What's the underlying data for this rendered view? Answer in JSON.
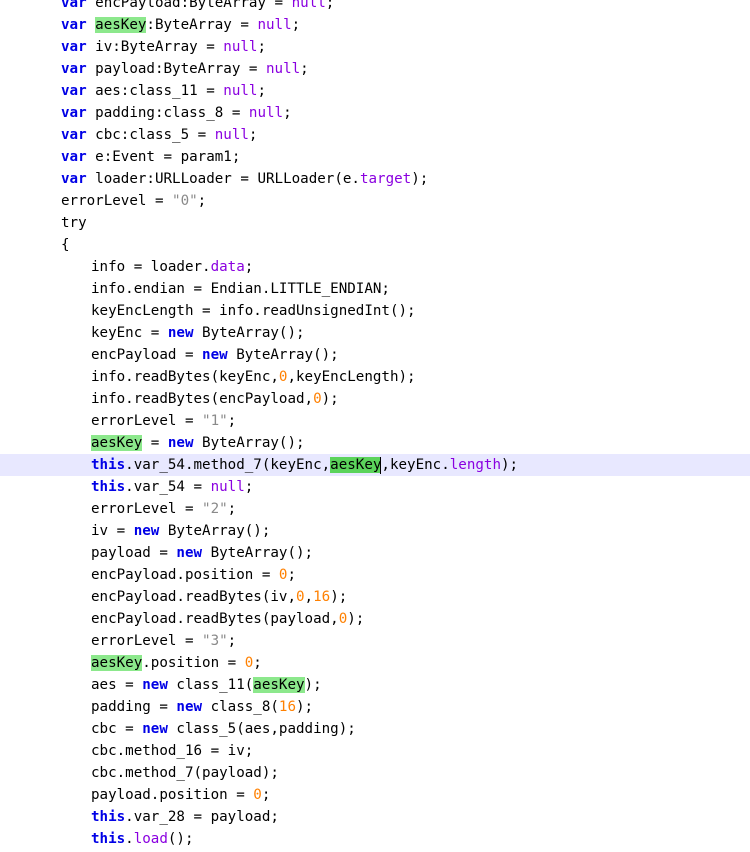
{
  "code": {
    "current_line": 21,
    "lines": [
      {
        "indent": 0,
        "tokens": [
          {
            "t": "var",
            "k": "kw"
          },
          {
            "t": " encPayload:ByteArray = "
          },
          {
            "t": "null",
            "k": "pr"
          },
          {
            "t": ";"
          }
        ]
      },
      {
        "indent": 0,
        "tokens": [
          {
            "t": "var",
            "k": "kw"
          },
          {
            "t": " "
          },
          {
            "t": "aesKey",
            "k": "hl"
          },
          {
            "t": ":ByteArray = "
          },
          {
            "t": "null",
            "k": "pr"
          },
          {
            "t": ";"
          }
        ]
      },
      {
        "indent": 0,
        "tokens": [
          {
            "t": "var",
            "k": "kw"
          },
          {
            "t": " iv:ByteArray = "
          },
          {
            "t": "null",
            "k": "pr"
          },
          {
            "t": ";"
          }
        ]
      },
      {
        "indent": 0,
        "tokens": [
          {
            "t": "var",
            "k": "kw"
          },
          {
            "t": " payload:ByteArray = "
          },
          {
            "t": "null",
            "k": "pr"
          },
          {
            "t": ";"
          }
        ]
      },
      {
        "indent": 0,
        "tokens": [
          {
            "t": "var",
            "k": "kw"
          },
          {
            "t": " aes:class_11 = "
          },
          {
            "t": "null",
            "k": "pr"
          },
          {
            "t": ";"
          }
        ]
      },
      {
        "indent": 0,
        "tokens": [
          {
            "t": "var",
            "k": "kw"
          },
          {
            "t": " padding:class_8 = "
          },
          {
            "t": "null",
            "k": "pr"
          },
          {
            "t": ";"
          }
        ]
      },
      {
        "indent": 0,
        "tokens": [
          {
            "t": "var",
            "k": "kw"
          },
          {
            "t": " cbc:class_5 = "
          },
          {
            "t": "null",
            "k": "pr"
          },
          {
            "t": ";"
          }
        ]
      },
      {
        "indent": 0,
        "tokens": [
          {
            "t": "var",
            "k": "kw"
          },
          {
            "t": " e:Event = param1;"
          }
        ]
      },
      {
        "indent": 0,
        "tokens": [
          {
            "t": "var",
            "k": "kw"
          },
          {
            "t": " loader:URLLoader = URLLoader(e."
          },
          {
            "t": "target",
            "k": "pr"
          },
          {
            "t": ");"
          }
        ]
      },
      {
        "indent": 0,
        "tokens": [
          {
            "t": "errorLevel = "
          },
          {
            "t": "\"0\"",
            "k": "st"
          },
          {
            "t": ";"
          }
        ]
      },
      {
        "indent": 0,
        "tokens": [
          {
            "t": "try"
          }
        ]
      },
      {
        "indent": 0,
        "tokens": [
          {
            "t": "{"
          }
        ]
      },
      {
        "indent": 1,
        "tokens": [
          {
            "t": "info = loader."
          },
          {
            "t": "data",
            "k": "pr"
          },
          {
            "t": ";"
          }
        ]
      },
      {
        "indent": 1,
        "tokens": [
          {
            "t": "info.endian = Endian.LITTLE_ENDIAN;"
          }
        ]
      },
      {
        "indent": 1,
        "tokens": [
          {
            "t": "keyEncLength = info.readUnsignedInt();"
          }
        ]
      },
      {
        "indent": 1,
        "tokens": [
          {
            "t": "keyEnc = "
          },
          {
            "t": "new",
            "k": "kw"
          },
          {
            "t": " ByteArray();"
          }
        ]
      },
      {
        "indent": 1,
        "tokens": [
          {
            "t": "encPayload = "
          },
          {
            "t": "new",
            "k": "kw"
          },
          {
            "t": " ByteArray();"
          }
        ]
      },
      {
        "indent": 1,
        "tokens": [
          {
            "t": "info.readBytes(keyEnc,"
          },
          {
            "t": "0",
            "k": "nm"
          },
          {
            "t": ",keyEncLength);"
          }
        ]
      },
      {
        "indent": 1,
        "tokens": [
          {
            "t": "info.readBytes(encPayload,"
          },
          {
            "t": "0",
            "k": "nm"
          },
          {
            "t": ");"
          }
        ]
      },
      {
        "indent": 1,
        "tokens": [
          {
            "t": "errorLevel = "
          },
          {
            "t": "\"1\"",
            "k": "st"
          },
          {
            "t": ";"
          }
        ]
      },
      {
        "indent": 1,
        "tokens": [
          {
            "t": "aesKey",
            "k": "hl"
          },
          {
            "t": " = "
          },
          {
            "t": "new",
            "k": "kw"
          },
          {
            "t": " ByteArray();"
          }
        ]
      },
      {
        "indent": 1,
        "tokens": [
          {
            "t": "this",
            "k": "kw"
          },
          {
            "t": ".var_54.method_7(keyEnc,"
          },
          {
            "t": "aesKey",
            "k": "hl sel"
          },
          {
            "t": "",
            "k": "caret"
          },
          {
            "t": ",keyEnc."
          },
          {
            "t": "length",
            "k": "pr"
          },
          {
            "t": ");"
          }
        ]
      },
      {
        "indent": 1,
        "tokens": [
          {
            "t": "this",
            "k": "kw"
          },
          {
            "t": ".var_54 = "
          },
          {
            "t": "null",
            "k": "pr"
          },
          {
            "t": ";"
          }
        ]
      },
      {
        "indent": 1,
        "tokens": [
          {
            "t": "errorLevel = "
          },
          {
            "t": "\"2\"",
            "k": "st"
          },
          {
            "t": ";"
          }
        ]
      },
      {
        "indent": 1,
        "tokens": [
          {
            "t": "iv = "
          },
          {
            "t": "new",
            "k": "kw"
          },
          {
            "t": " ByteArray();"
          }
        ]
      },
      {
        "indent": 1,
        "tokens": [
          {
            "t": "payload = "
          },
          {
            "t": "new",
            "k": "kw"
          },
          {
            "t": " ByteArray();"
          }
        ]
      },
      {
        "indent": 1,
        "tokens": [
          {
            "t": "encPayload.position = "
          },
          {
            "t": "0",
            "k": "nm"
          },
          {
            "t": ";"
          }
        ]
      },
      {
        "indent": 1,
        "tokens": [
          {
            "t": "encPayload.readBytes(iv,"
          },
          {
            "t": "0",
            "k": "nm"
          },
          {
            "t": ","
          },
          {
            "t": "16",
            "k": "nm"
          },
          {
            "t": ");"
          }
        ]
      },
      {
        "indent": 1,
        "tokens": [
          {
            "t": "encPayload.readBytes(payload,"
          },
          {
            "t": "0",
            "k": "nm"
          },
          {
            "t": ");"
          }
        ]
      },
      {
        "indent": 1,
        "tokens": [
          {
            "t": "errorLevel = "
          },
          {
            "t": "\"3\"",
            "k": "st"
          },
          {
            "t": ";"
          }
        ]
      },
      {
        "indent": 1,
        "tokens": [
          {
            "t": "aesKey",
            "k": "hl"
          },
          {
            "t": ".position = "
          },
          {
            "t": "0",
            "k": "nm"
          },
          {
            "t": ";"
          }
        ]
      },
      {
        "indent": 1,
        "tokens": [
          {
            "t": "aes = "
          },
          {
            "t": "new",
            "k": "kw"
          },
          {
            "t": " class_11("
          },
          {
            "t": "aesKey",
            "k": "hl"
          },
          {
            "t": ");"
          }
        ]
      },
      {
        "indent": 1,
        "tokens": [
          {
            "t": "padding = "
          },
          {
            "t": "new",
            "k": "kw"
          },
          {
            "t": " class_8("
          },
          {
            "t": "16",
            "k": "nm"
          },
          {
            "t": ");"
          }
        ]
      },
      {
        "indent": 1,
        "tokens": [
          {
            "t": "cbc = "
          },
          {
            "t": "new",
            "k": "kw"
          },
          {
            "t": " class_5(aes,padding);"
          }
        ]
      },
      {
        "indent": 1,
        "tokens": [
          {
            "t": "cbc.method_16 = iv;"
          }
        ]
      },
      {
        "indent": 1,
        "tokens": [
          {
            "t": "cbc.method_7(payload);"
          }
        ]
      },
      {
        "indent": 1,
        "tokens": [
          {
            "t": "payload.position = "
          },
          {
            "t": "0",
            "k": "nm"
          },
          {
            "t": ";"
          }
        ]
      },
      {
        "indent": 1,
        "tokens": [
          {
            "t": "this",
            "k": "kw"
          },
          {
            "t": ".var_28 = payload;"
          }
        ]
      },
      {
        "indent": 1,
        "tokens": [
          {
            "t": "this",
            "k": "kw"
          },
          {
            "t": "."
          },
          {
            "t": "load",
            "k": "pr"
          },
          {
            "t": "();"
          }
        ]
      }
    ]
  },
  "colors": {
    "keyword": "#0000e6",
    "property": "#8a00e0",
    "string": "#8a8a8a",
    "number": "#ff8000",
    "highlight": "#8ce88c",
    "current_line": "#e8e8ff"
  }
}
